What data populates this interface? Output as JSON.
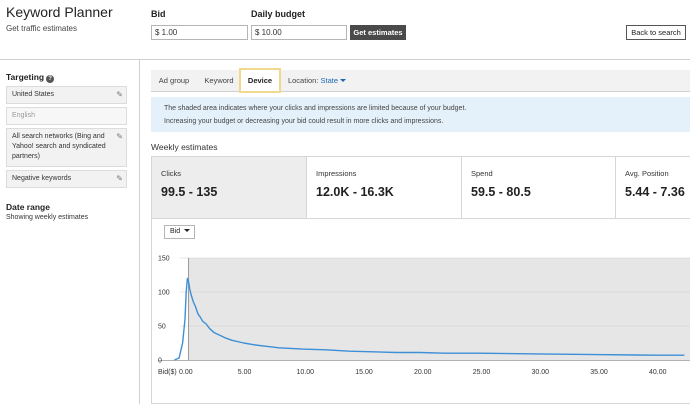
{
  "header": {
    "title": "Keyword Planner",
    "subtitle": "Get traffic estimates",
    "bid_label": "Bid",
    "bid_value": "$ 1.00",
    "budget_label": "Daily budget",
    "budget_value": "$ 10.00",
    "get_estimates_label": "Get estimates",
    "back_label": "Back to search"
  },
  "sidebar": {
    "targeting_heading": "Targeting",
    "items": [
      {
        "label": "United States",
        "editable": true
      },
      {
        "label": "English",
        "editable": false
      },
      {
        "label": "All search networks (Bing and Yahoo! search and syndicated partners)",
        "editable": true
      },
      {
        "label": "Negative keywords",
        "editable": true
      }
    ],
    "date_range_heading": "Date range",
    "date_range_value": "Showing weekly estimates"
  },
  "tabs": {
    "ad_group": "Ad group",
    "keyword": "Keyword",
    "device": "Device",
    "location_label": "Location:",
    "location_value": "State",
    "active": "Device"
  },
  "info": {
    "line1": "The shaded area indicates where your clicks and impressions are limited because of your budget.",
    "line2": "Increasing your budget or decreasing your bid could result in more clicks and impressions."
  },
  "estimates": {
    "heading": "Weekly estimates",
    "metrics": [
      {
        "label": "Clicks",
        "value": "99.5 - 135",
        "selected": true
      },
      {
        "label": "Impressions",
        "value": "12.0K - 16.3K",
        "selected": false
      },
      {
        "label": "Spend",
        "value": "59.5 - 80.5",
        "selected": false
      },
      {
        "label": "Avg. Position",
        "value": "5.44 - 7.36",
        "selected": false
      }
    ],
    "dropdown_label": "Bid"
  },
  "colors": {
    "line": "#3d8fd6",
    "shaded": "#e6e6e6",
    "info_bg": "#e4f1fa",
    "active_tab_border": "#f0d98a",
    "link": "#1a67b5"
  },
  "chart_data": {
    "type": "line",
    "xlabel": "Bid($)",
    "xlim": [
      0,
      42.5
    ],
    "ylim": [
      0,
      150
    ],
    "x_ticks": [
      "0.00",
      "5.00",
      "10.00",
      "15.00",
      "20.00",
      "25.00",
      "30.00",
      "35.00",
      "40.00"
    ],
    "x_tick_values": [
      0,
      5,
      10,
      15,
      20,
      25,
      30,
      35,
      40
    ],
    "y_ticks": [
      "0",
      "50",
      "100",
      "150"
    ],
    "y_tick_values": [
      0,
      50,
      100,
      150
    ],
    "shaded_from_x": 0.3,
    "series": [
      {
        "x": [
          -0.9,
          -0.5,
          -0.2,
          0.0,
          0.1,
          0.2,
          0.3,
          0.4,
          0.5,
          0.7,
          0.9,
          1.1,
          1.3,
          1.5,
          1.8,
          2.1,
          2.5,
          3.0,
          3.5,
          4.0,
          5.0,
          6.0,
          7.0,
          8.0,
          9.0,
          10.0,
          12.0,
          14.0,
          16.0,
          18.0,
          20.0,
          22.0,
          25.0,
          30.0,
          35.0,
          40.0,
          42.5
        ],
        "y": [
          0,
          3,
          25,
          60,
          100,
          120,
          115,
          105,
          97,
          86,
          78,
          68,
          63,
          57,
          53,
          46,
          40,
          36,
          32,
          29,
          25,
          22,
          20,
          18,
          17,
          16,
          15,
          13,
          12,
          11,
          11,
          10,
          10,
          9,
          8,
          7,
          7
        ]
      }
    ]
  }
}
